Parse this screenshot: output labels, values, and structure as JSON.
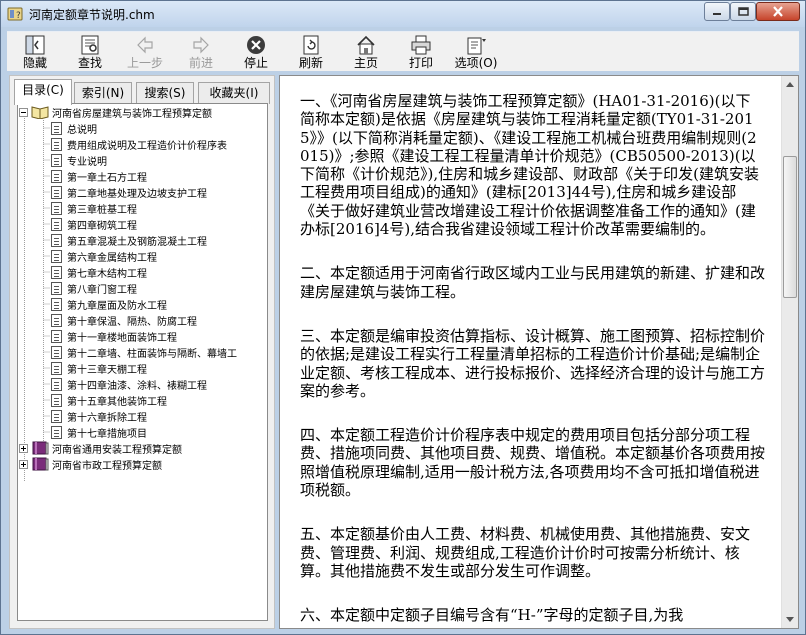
{
  "window": {
    "title": "河南定额章节说明.chm"
  },
  "toolbar": {
    "hide": "隐藏",
    "find": "查找",
    "back": "上一步",
    "forward": "前进",
    "stop": "停止",
    "refresh": "刷新",
    "home": "主页",
    "print": "打印",
    "options": "选项(O)"
  },
  "tabs": [
    "目录(C)",
    "索引(N)",
    "搜索(S)",
    "收藏夹(I)"
  ],
  "tree": {
    "book1": "河南省房屋建筑与装饰工程预算定额",
    "items": [
      "总说明",
      "费用组成说明及工程造价计价程序表",
      "专业说明",
      "第一章土石方工程",
      "第二章地基处理及边坡支护工程",
      "第三章桩基工程",
      "第四章砌筑工程",
      "第五章混凝土及钢筋混凝土工程",
      "第六章金属结构工程",
      "第七章木结构工程",
      "第八章门窗工程",
      "第九章屋面及防水工程",
      "第十章保温、隔热、防腐工程",
      "第十一章楼地面装饰工程",
      "第十二章墙、柱面装饰与隔断、幕墙工",
      "第十三章天棚工程",
      "第十四章油漆、涂料、裱糊工程",
      "第十五章其他装饰工程",
      "第十六章拆除工程",
      "第十七章措施项目"
    ],
    "book2": "河南省通用安装工程预算定额",
    "book3": "河南省市政工程预算定额"
  },
  "content": {
    "paragraphs": [
      "一、《河南省房屋建筑与装饰工程预算定额》(HA01-31-2016)(以下简称本定额)是依据《房屋建筑与装饰工程消耗量定额(TY01-31-2015》》(以下简称消耗量定额)、《建设工程施工机械台班费用编制规则(2015)》;参照《建设工程工程量清单计价规范》(CB50500-2013)(以下简称《计价规范》),住房和城乡建设部、财政部《关于印发(建筑安装工程费用项目组成)的通知》(建标[2013]44号),住房和城乡建设部《关于做好建筑业营改增建设工程计价依据调整准备工作的通知》(建办标[2016]4号),结合我省建设领域工程计价改革需要编制的。",
      "二、本定额适用于河南省行政区域内工业与民用建筑的新建、扩建和改建房屋建筑与装饰工程。",
      "三、本定额是编审投资估算指标、设计概算、施工图预算、招标控制价的依据;是建设工程实行工程量清单招标的工程造价计价基础;是编制企业定额、考核工程成本、进行投标报价、选择经济合理的设计与施工方案的参考。",
      "四、本定额工程造价计价程序表中规定的费用项目包括分部分项工程费、措施项同费、其他项目费、规费、增值税。本定额基价各项费用按照增值税原理编制,适用一般计税方法,各项费用均不含可抵扣增值税进项税额。",
      "五、本定额基价由人工费、材料费、机械使用费、其他措施费、安文费、管理费、利润、规费组成,工程造价计价时可按需分析统计、核算。其他措施费不发生或部分发生可作调整。",
      "六、本定额中定额子目编号含有“H-”字母的定额子目,为我"
    ]
  }
}
